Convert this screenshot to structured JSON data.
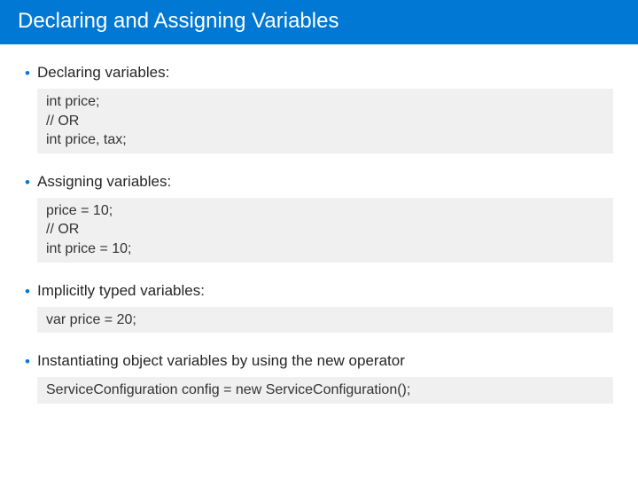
{
  "header": {
    "title": "Declaring and Assigning Variables"
  },
  "sections": [
    {
      "label": "Declaring variables:",
      "code": "int price;\n// OR\nint price, tax;"
    },
    {
      "label": "Assigning variables:",
      "code": "price = 10;\n// OR\nint price = 10;"
    },
    {
      "label": "Implicitly typed variables:",
      "code": "var price = 20;"
    },
    {
      "label": "Instantiating object variables by using the new operator",
      "code": "ServiceConfiguration config = new ServiceConfiguration();"
    }
  ]
}
